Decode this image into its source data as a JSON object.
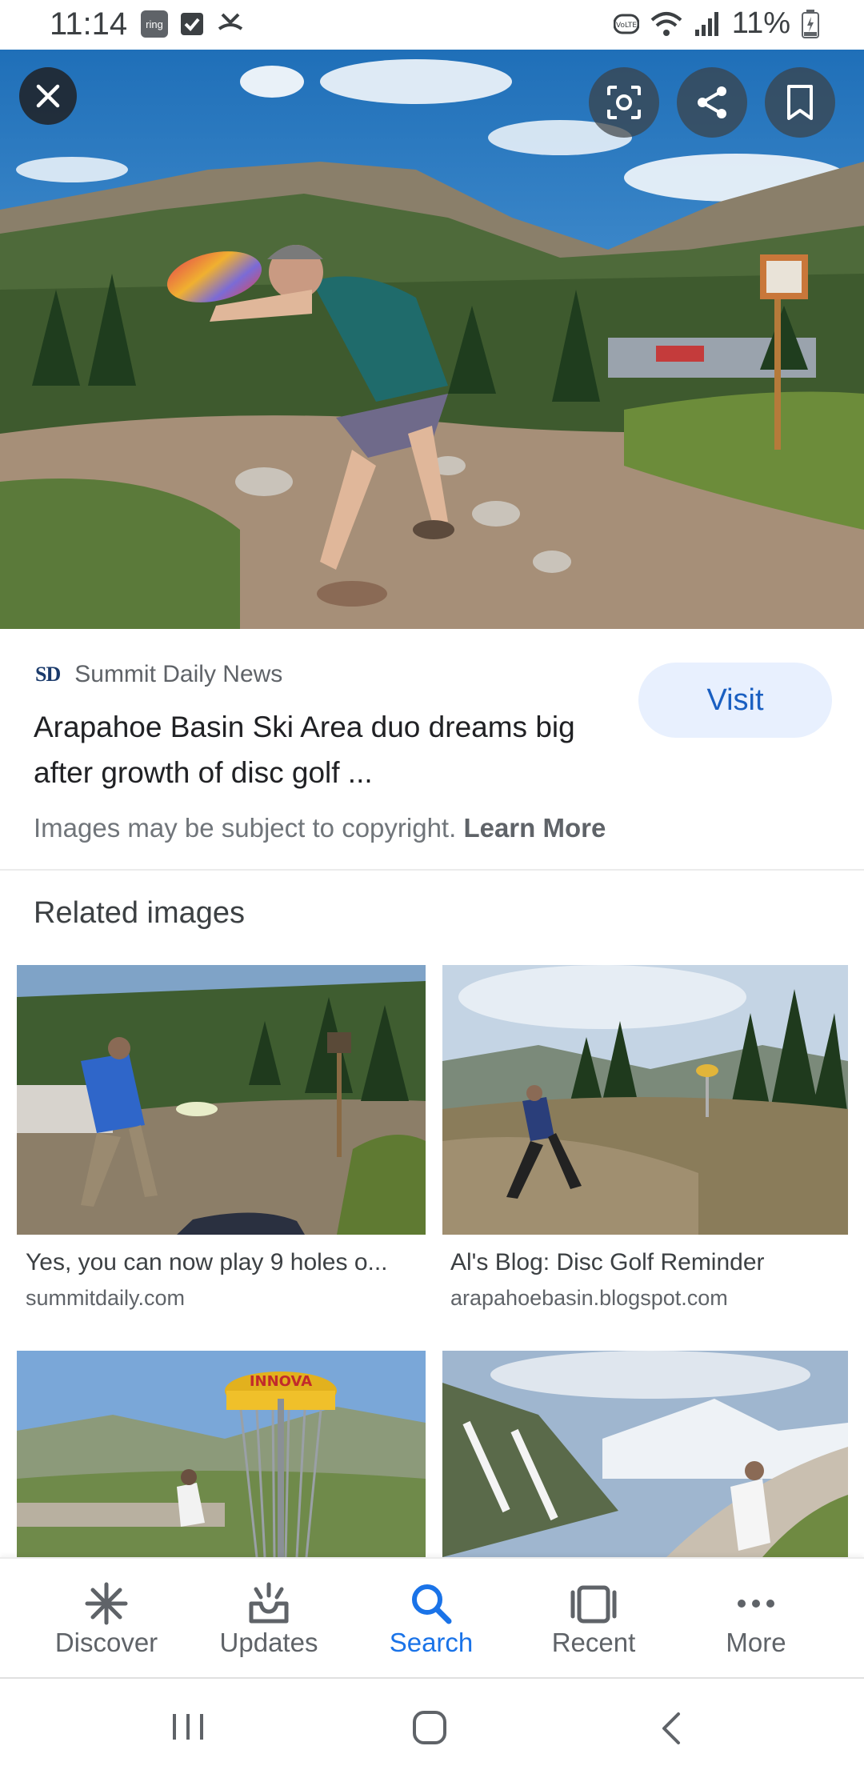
{
  "status_bar": {
    "time": "11:14",
    "left_icons": [
      "ring",
      "checkbox-icon",
      "missed-call-icon"
    ],
    "right_icons": [
      "volte-icon",
      "wifi-icon",
      "signal-icon"
    ],
    "battery": "11%"
  },
  "hero": {
    "buttons": [
      "close-icon",
      "lens-icon",
      "share-icon",
      "bookmark-icon"
    ]
  },
  "source": {
    "logo": "SD",
    "name": "Summit Daily News",
    "title": "Arapahoe Basin Ski Area duo dreams big after growth of disc golf ...",
    "visit_label": "Visit",
    "copyright_text": "Images may be subject to copyright.",
    "learn_more": "Learn More"
  },
  "related": {
    "heading": "Related images",
    "items": [
      {
        "caption": "Yes, you can now play 9 holes o...",
        "domain": "summitdaily.com"
      },
      {
        "caption": "Al's Blog: Disc Golf Reminder",
        "domain": "arapahoebasin.blogspot.com"
      },
      {
        "caption": "",
        "domain": ""
      },
      {
        "caption": "",
        "domain": ""
      }
    ]
  },
  "bottom_nav": {
    "items": [
      {
        "label": "Discover",
        "icon": "asterisk-icon"
      },
      {
        "label": "Updates",
        "icon": "inbox-icon"
      },
      {
        "label": "Search",
        "icon": "search-icon",
        "active": true
      },
      {
        "label": "Recent",
        "icon": "recent-icon"
      },
      {
        "label": "More",
        "icon": "more-icon"
      }
    ]
  },
  "colors": {
    "accent": "#1a73e8",
    "visit_bg": "#e8f0fe",
    "text_primary": "#202124",
    "text_secondary": "#5f6368"
  }
}
